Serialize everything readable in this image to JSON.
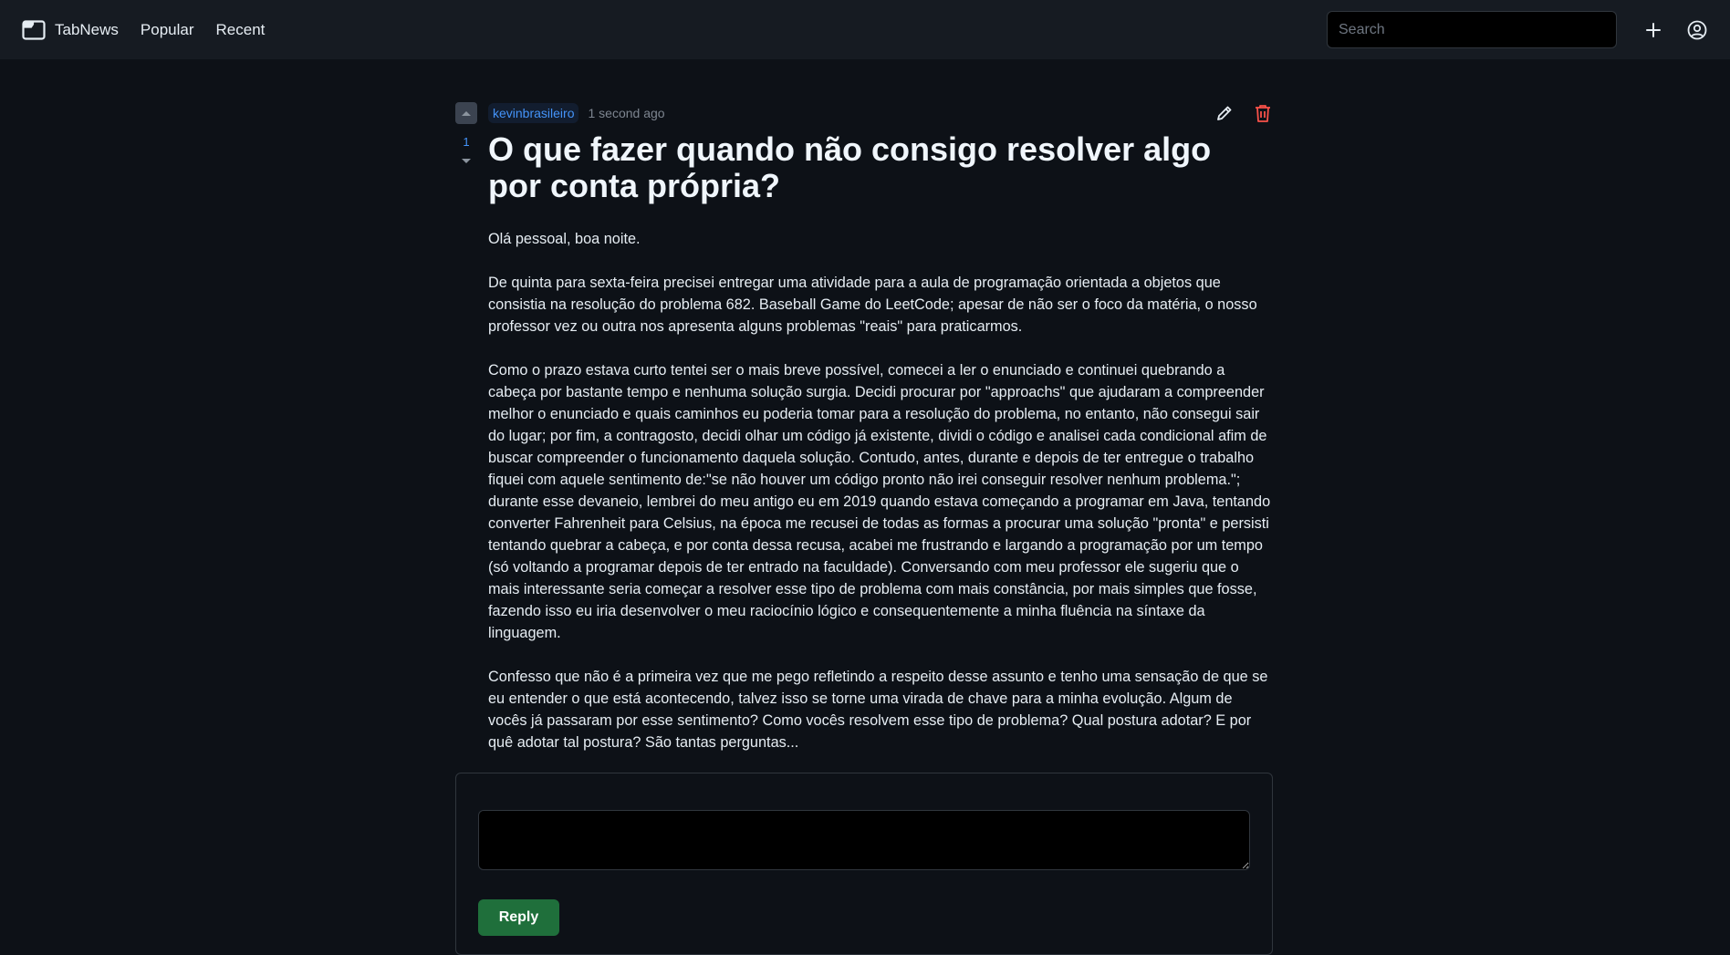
{
  "header": {
    "logo_text": "TabNews",
    "nav": [
      {
        "label": "Popular"
      },
      {
        "label": "Recent"
      }
    ],
    "search_placeholder": "Search",
    "icons": [
      "folder-icon",
      "plus-icon",
      "user-circle-icon"
    ]
  },
  "post": {
    "vote_count": "1",
    "author": "kevinbrasileiro",
    "time": "1 second ago",
    "title": "O que fazer quando não consigo resolver algo por conta própria?",
    "paragraphs": [
      "Olá pessoal, boa noite.",
      "De quinta para sexta-feira precisei entregar uma atividade para a aula de programação orientada a objetos que consistia na resolução do problema 682. Baseball Game do LeetCode; apesar de não ser o foco da matéria, o nosso professor vez ou outra nos apresenta alguns problemas \"reais\" para praticarmos.",
      "Como o prazo estava curto tentei ser o mais breve possível, comecei a ler o enunciado e continuei quebrando a cabeça por bastante tempo e nenhuma solução surgia. Decidi procurar por \"approachs\" que ajudaram a compreender melhor o enunciado e quais caminhos eu poderia tomar para a resolução do problema, no entanto, não consegui sair do lugar; por fim, a contragosto, decidi olhar um código já existente, dividi o código e analisei cada condicional afim de buscar compreender o funcionamento daquela solução. Contudo, antes, durante e depois de ter entregue o trabalho fiquei com aquele sentimento de:\"se não houver um código pronto não irei conseguir resolver nenhum problema.\"; durante esse devaneio, lembrei do meu antigo eu em 2019 quando estava começando a programar em Java, tentando converter Fahrenheit para Celsius, na época me recusei de todas as formas a procurar uma solução \"pronta\" e persisti tentando quebrar a cabeça, e por conta dessa recusa, acabei me frustrando e largando a programação por um tempo (só voltando a programar depois de ter entrado na faculdade). Conversando com meu professor ele sugeriu que o mais interessante seria começar a resolver esse tipo de problema com mais constância, por mais simples que fosse, fazendo isso eu iria desenvolver o meu raciocínio lógico e consequentemente a minha fluência na síntaxe da linguagem.",
      "Confesso que não é a primeira vez que me pego refletindo a respeito desse assunto e tenho uma sensação de que se eu entender o que está acontecendo, talvez isso se torne uma virada de chave para a minha evolução. Algum de vocês já passaram por esse sentimento? Como vocês resolvem esse tipo de problema? Qual postura adotar? E por quê adotar tal postura? São tantas perguntas..."
    ],
    "icons": [
      "upvote-icon",
      "downvote-icon",
      "pencil-icon",
      "trash-icon"
    ],
    "accent_color": "#4493f8",
    "delete_color": "#f85149"
  },
  "reply": {
    "button_label": "Reply",
    "button_color": "#1f6f3b"
  }
}
